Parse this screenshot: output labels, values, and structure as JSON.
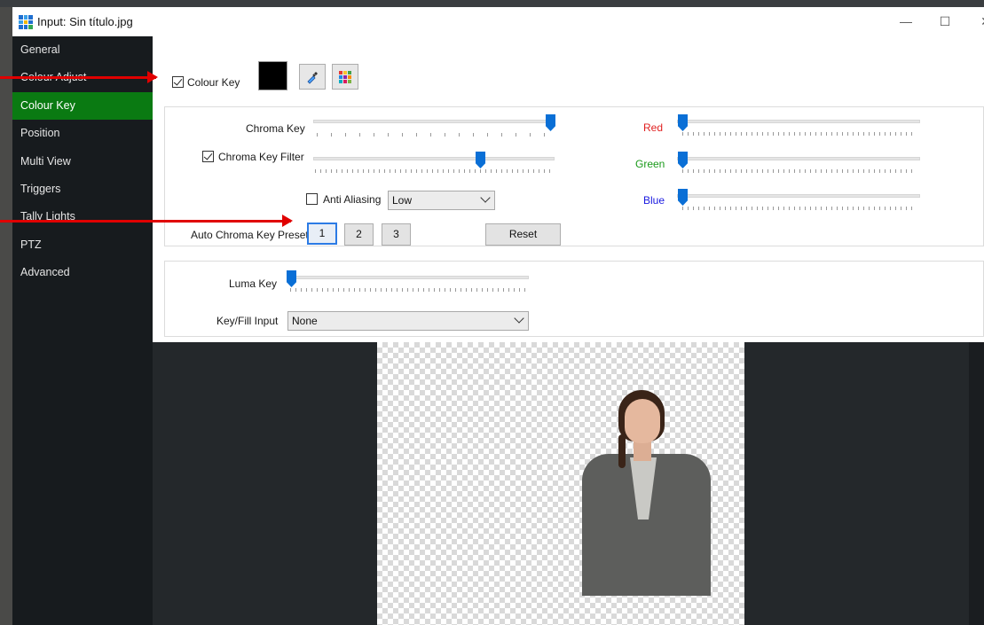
{
  "window": {
    "title": "Input: Sin título.jpg"
  },
  "sidebar": {
    "items": [
      {
        "label": "General"
      },
      {
        "label": "Colour Adjust"
      },
      {
        "label": "Colour Key"
      },
      {
        "label": "Position"
      },
      {
        "label": "Multi View"
      },
      {
        "label": "Triggers"
      },
      {
        "label": "Tally Lights"
      },
      {
        "label": "PTZ"
      },
      {
        "label": "Advanced"
      }
    ],
    "active_index": 2
  },
  "colour_key": {
    "label": "Colour Key",
    "checked": true,
    "swatch_color": "#000000",
    "eyedropper_icon": "eyedropper-icon",
    "palette_icon": "color-palette-icon"
  },
  "chroma": {
    "chroma_key_label": "Chroma Key",
    "chroma_key_filter_label": "Chroma Key Filter",
    "chroma_key_filter_checked": true,
    "anti_aliasing_label": "Anti Aliasing",
    "anti_aliasing_checked": false,
    "anti_aliasing_value": "Low",
    "presets_label": "Auto Chroma Key Presets",
    "presets": [
      "1",
      "2",
      "3"
    ],
    "reset_label": "Reset",
    "red_label": "Red",
    "green_label": "Green",
    "blue_label": "Blue",
    "red_color": "#e02020",
    "green_color": "#1a9a1a",
    "blue_color": "#1a1ae0"
  },
  "luma": {
    "luma_key_label": "Luma Key",
    "key_fill_label": "Key/Fill Input",
    "key_fill_value": "None"
  },
  "colors": {
    "accent": "#0a7a12",
    "slider_thumb": "#0a6fd6",
    "annotation_arrow": "#e00000"
  }
}
